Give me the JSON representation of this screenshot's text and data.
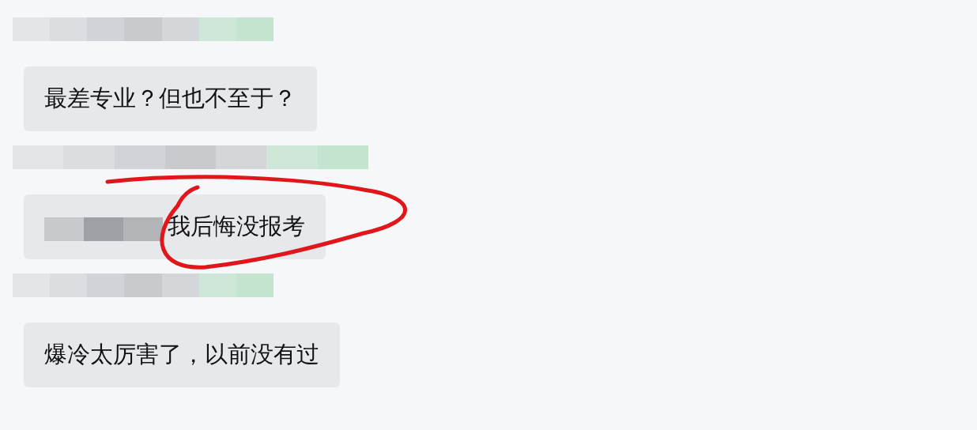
{
  "messages": [
    {
      "text": "最差专业？但也不至于？",
      "redacted_prefix": false,
      "circled": false
    },
    {
      "text": "我后悔没报考",
      "redacted_prefix": true,
      "circled": true
    },
    {
      "text": "爆冷太厉害了，以前没有过",
      "redacted_prefix": false,
      "circled": false
    }
  ]
}
